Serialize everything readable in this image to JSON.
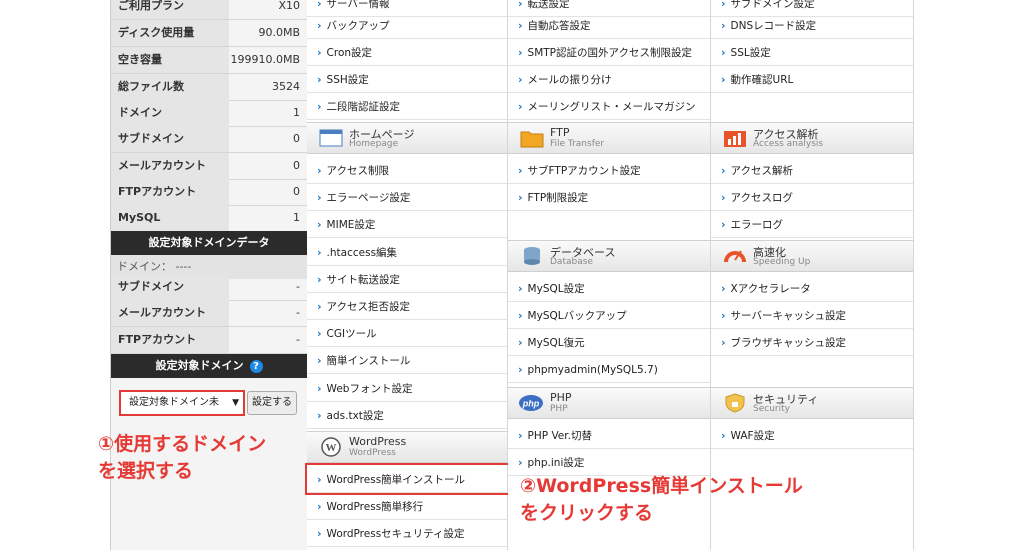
{
  "sidebar": {
    "stats": [
      {
        "label": "ご利用プラン",
        "value": "X10"
      },
      {
        "label": "ディスク使用量",
        "value": "90.0MB"
      },
      {
        "label": "空き容量",
        "value": "199910.0MB"
      },
      {
        "label": "総ファイル数",
        "value": "3524"
      },
      {
        "label": "ドメイン",
        "value": "1"
      },
      {
        "label": "サブドメイン",
        "value": "0"
      },
      {
        "label": "メールアカウント",
        "value": "0"
      },
      {
        "label": "FTPアカウント",
        "value": "0"
      },
      {
        "label": "MySQL",
        "value": "1"
      }
    ],
    "domain_data_header": "設定対象ドメインデータ",
    "domain_line": "ドメイン： ----",
    "domain_stats": [
      {
        "label": "サブドメイン",
        "value": "-"
      },
      {
        "label": "メールアカウント",
        "value": "-"
      },
      {
        "label": "FTPアカウント",
        "value": "-"
      }
    ],
    "target_domain_header": "設定対象ドメイン",
    "help_glyph": "?",
    "select_value": "設定対象ドメイン未",
    "set_button": "設定する"
  },
  "col1": {
    "top_items": [
      "バックアップ",
      "Cron設定",
      "SSH設定",
      "二段階認証設定"
    ],
    "homepage": {
      "title": "ホームページ",
      "subtitle": "Homepage"
    },
    "homepage_items": [
      "アクセス制限",
      "エラーページ設定",
      "MIME設定",
      ".htaccess編集",
      "サイト転送設定",
      "アクセス拒否設定",
      "CGIツール",
      "簡単インストール",
      "Webフォント設定",
      "ads.txt設定"
    ],
    "wordpress": {
      "title": "WordPress",
      "subtitle": "WordPress"
    },
    "wordpress_items": [
      "WordPress簡単インストール",
      "WordPress簡単移行",
      "WordPressセキュリティ設定"
    ]
  },
  "col2": {
    "top_items": [
      "自動応答設定",
      "SMTP認証の国外アクセス制限設定",
      "メールの振り分け",
      "メーリングリスト・メールマガジン"
    ],
    "ftp": {
      "title": "FTP",
      "subtitle": "File Transfer"
    },
    "ftp_items": [
      "サブFTPアカウント設定",
      "FTP制限設定"
    ],
    "database": {
      "title": "データベース",
      "subtitle": "Database"
    },
    "database_items": [
      "MySQL設定",
      "MySQLバックアップ",
      "MySQL復元",
      "phpmyadmin(MySQL5.7)"
    ],
    "php": {
      "title": "PHP",
      "subtitle": "PHP"
    },
    "php_items": [
      "PHP Ver.切替",
      "php.ini設定"
    ]
  },
  "col3": {
    "top_items": [
      "DNSレコード設定",
      "SSL設定",
      "動作確認URL"
    ],
    "access": {
      "title": "アクセス解析",
      "subtitle": "Access analysis"
    },
    "access_items": [
      "アクセス解析",
      "アクセスログ",
      "エラーログ"
    ],
    "speed": {
      "title": "高速化",
      "subtitle": "Speeding Up"
    },
    "speed_items": [
      "Xアクセラレータ",
      "サーバーキャッシュ設定",
      "ブラウザキャッシュ設定"
    ],
    "security": {
      "title": "セキュリティ",
      "subtitle": "Security"
    },
    "security_items": [
      "WAF設定"
    ]
  },
  "annotations": {
    "step1_line1": "①使用するドメイン",
    "step1_line2": "を選択する",
    "step2_line1": "②WordPress簡単インストール",
    "step2_line2": "をクリックする"
  },
  "colors": {
    "annotation_red": "#e53935",
    "link_arrow": "#1e73be",
    "dark_bar": "#2b2b2b",
    "php_blue": "#3b6fc4"
  }
}
